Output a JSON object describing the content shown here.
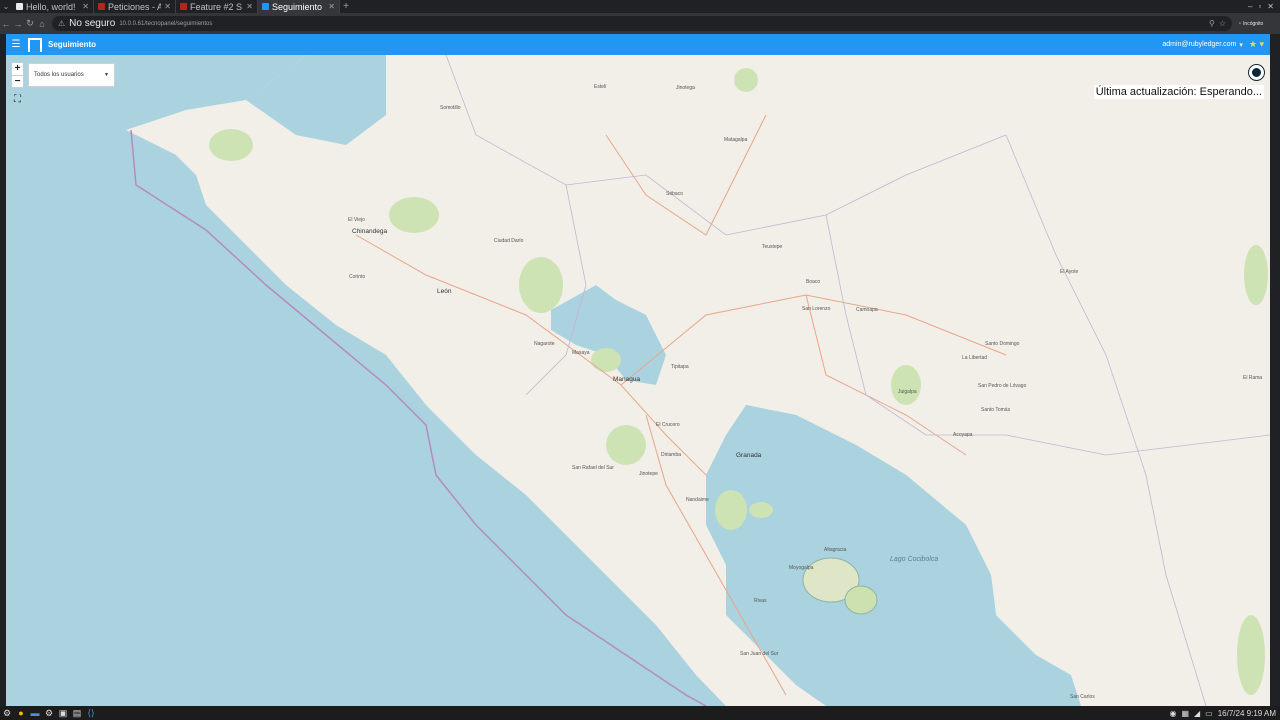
{
  "browser": {
    "tabs": [
      {
        "title": "Hello, world!",
        "fav": "#e8eaed",
        "active": false
      },
      {
        "title": "Peticiones - A",
        "fav": "#b3261e",
        "active": false
      },
      {
        "title": "Feature #2 S",
        "fav": "#b3261e",
        "active": false
      },
      {
        "title": "Seguimiento",
        "fav": "#2196f3",
        "active": true
      }
    ],
    "security_label": "No seguro",
    "url": "10.0.0.61/tecnopanel/seguimientos",
    "incognito_label": "Incógnito"
  },
  "app": {
    "title": "Seguimiento",
    "user": "admin@rubyledger.com",
    "accent": "#2196f3"
  },
  "map": {
    "user_filter": "Todos los usuarios",
    "zoom_in": "+",
    "zoom_out": "−",
    "status": "Última actualización: Esperando...",
    "places": [
      "Chinandega",
      "León",
      "Managua",
      "Granada",
      "Masaya",
      "Jinotepe",
      "Rivas",
      "Boaco",
      "Matagalpa",
      "Jinotega",
      "Estelí",
      "Juigalpa",
      "Acoyapa",
      "San Carlos",
      "Lago Cocibolca",
      "Nagarote",
      "Ciudad Darío",
      "Tipitapa",
      "Somotillo",
      "El Viejo",
      "Corinto",
      "Diriamba",
      "Nandaime",
      "Moyogalpa",
      "Altagracia",
      "San Juan del Sur",
      "Sébaco",
      "San Lorenzo",
      "Camoapa",
      "Santo Tomás",
      "San Pedro de Lóvago",
      "El Ayote",
      "El Rama",
      "La Libertad",
      "Santo Domingo",
      "San Rafael del Sur",
      "El Crucero",
      "Teustepe"
    ]
  },
  "taskbar": {
    "clock": "16/7/24 9:19 AM"
  }
}
